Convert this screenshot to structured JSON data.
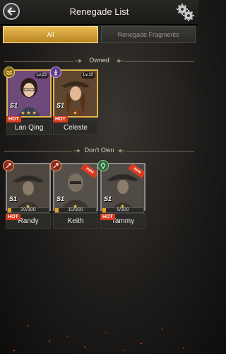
{
  "header": {
    "title": "Renegade List"
  },
  "tabs": [
    {
      "label": "All",
      "active": true
    },
    {
      "label": "Renegade Fragments",
      "active": false
    }
  ],
  "sections": {
    "owned": {
      "label": "Owned",
      "cards": [
        {
          "name": "Lan Qing",
          "level": "Lv.23",
          "rank": "S1",
          "stars": "★★★",
          "hot": "HOT",
          "frame": "gold"
        },
        {
          "name": "Celeste",
          "level": "Lv.10",
          "rank": "S1",
          "stars": "★",
          "hot": "HOT",
          "frame": "gold"
        }
      ]
    },
    "dont_own": {
      "label": "Don't Own",
      "cards": [
        {
          "name": "Randy",
          "rank": "S1",
          "stars": "★",
          "hot": "HOT",
          "progress": "20/300",
          "progress_fraction": 0.067
        },
        {
          "name": "Keith",
          "rank": "S1",
          "stars": "★",
          "progress": "10/300",
          "progress_fraction": 0.033,
          "badge": "new"
        },
        {
          "name": "Tammy",
          "rank": "S1",
          "stars": "★",
          "hot": "HOT",
          "progress": "5/300",
          "progress_fraction": 0.017,
          "badge": "new"
        }
      ]
    }
  },
  "colors": {
    "accent_gold": "#e0b44a",
    "hot_red": "#d83a20",
    "progress": "#e3a31d"
  },
  "icons": [
    "back-arrow-icon",
    "settings-gears-icon",
    "rank-chevron-icon",
    "faction-emblem-icon"
  ]
}
